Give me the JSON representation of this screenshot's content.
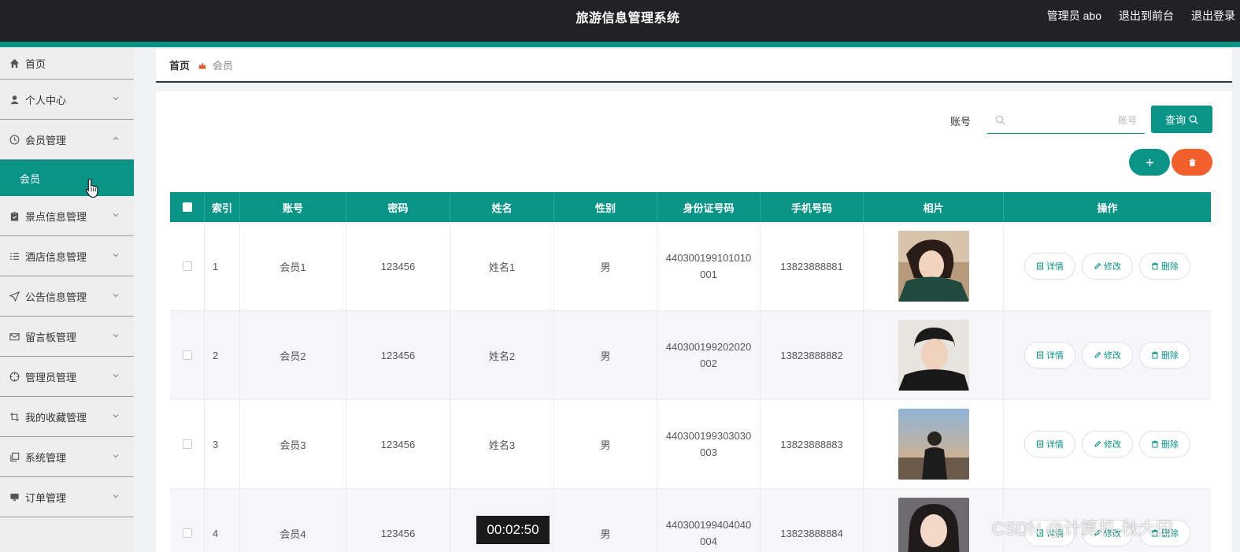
{
  "header": {
    "title": "旅游信息管理系统",
    "user_label": "管理员 abo",
    "back_label": "退出到前台",
    "logout_label": "退出登录"
  },
  "sidebar": {
    "items": [
      {
        "label": "首页",
        "icon": "home-icon"
      },
      {
        "label": "个人中心",
        "icon": "user-icon"
      },
      {
        "label": "会员管理",
        "icon": "clock-icon",
        "expanded": true
      },
      {
        "label": "会员",
        "sub": true,
        "active": true
      },
      {
        "label": "景点信息管理",
        "icon": "clipboard-icon"
      },
      {
        "label": "酒店信息管理",
        "icon": "list-icon"
      },
      {
        "label": "公告信息管理",
        "icon": "send-icon"
      },
      {
        "label": "留言板管理",
        "icon": "mail-icon"
      },
      {
        "label": "管理员管理",
        "icon": "compass-icon"
      },
      {
        "label": "我的收藏管理",
        "icon": "crop-icon"
      },
      {
        "label": "系统管理",
        "icon": "copy-icon"
      },
      {
        "label": "订单管理",
        "icon": "monitor-icon"
      }
    ]
  },
  "breadcrumb": {
    "home": "首页",
    "current": "会员"
  },
  "search": {
    "label": "账号",
    "placeholder": "账号",
    "value": "",
    "button": "查询"
  },
  "table": {
    "headers": [
      "索引",
      "账号",
      "密码",
      "姓名",
      "性别",
      "身份证号码",
      "手机号码",
      "相片",
      "操作"
    ],
    "rows": [
      {
        "index": "1",
        "account": "会员1",
        "password": "123456",
        "name": "姓名1",
        "gender": "男",
        "id_number": "440300199101010001",
        "phone": "13823888881"
      },
      {
        "index": "2",
        "account": "会员2",
        "password": "123456",
        "name": "姓名2",
        "gender": "男",
        "id_number": "440300199202020002",
        "phone": "13823888882"
      },
      {
        "index": "3",
        "account": "会员3",
        "password": "123456",
        "name": "姓名3",
        "gender": "男",
        "id_number": "440300199303030003",
        "phone": "13823888883"
      },
      {
        "index": "4",
        "account": "会员4",
        "password": "123456",
        "name": "",
        "gender": "男",
        "id_number": "440300199404040004",
        "phone": "13823888884"
      }
    ],
    "actions": {
      "detail": "详情",
      "edit": "修改",
      "delete": "删除"
    }
  },
  "overlay": {
    "timestamp": "00:02:50",
    "watermark": "CSDN @计算机-秋大田"
  },
  "colors": {
    "accent": "#099487",
    "danger": "#f25f2a",
    "header_bg": "#222124"
  }
}
